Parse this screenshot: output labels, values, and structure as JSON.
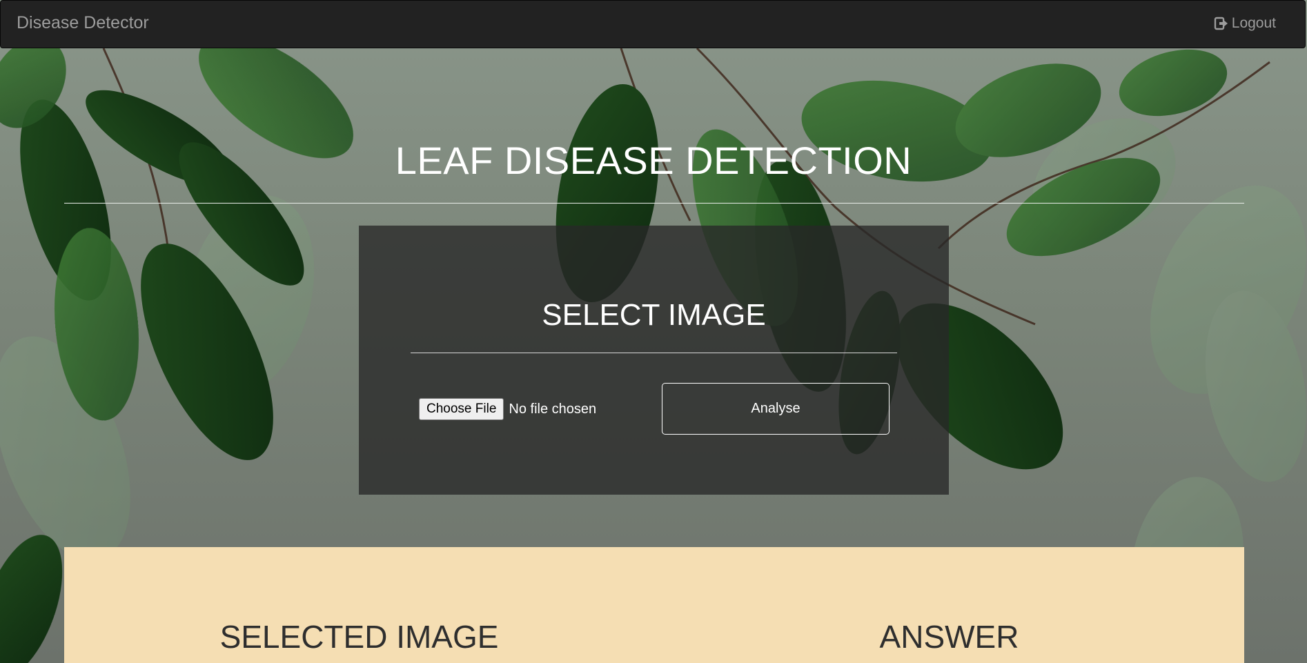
{
  "navbar": {
    "brand": "Disease Detector",
    "logout_label": "Logout",
    "logout_icon": "logout-icon"
  },
  "main": {
    "title": "LEAF DISEASE DETECTION"
  },
  "select_panel": {
    "title": "SELECT IMAGE",
    "choose_file_label": "Choose File",
    "file_status": "No file chosen",
    "analyse_label": "Analyse"
  },
  "results": {
    "selected_image_heading": "SELECTED IMAGE",
    "answer_heading": "ANSWER"
  },
  "colors": {
    "navbar_bg": "#222222",
    "navbar_text": "#9d9d9d",
    "panel_bg": "#282828",
    "results_bg": "#f5deb3",
    "heading_text": "#ffffff"
  }
}
